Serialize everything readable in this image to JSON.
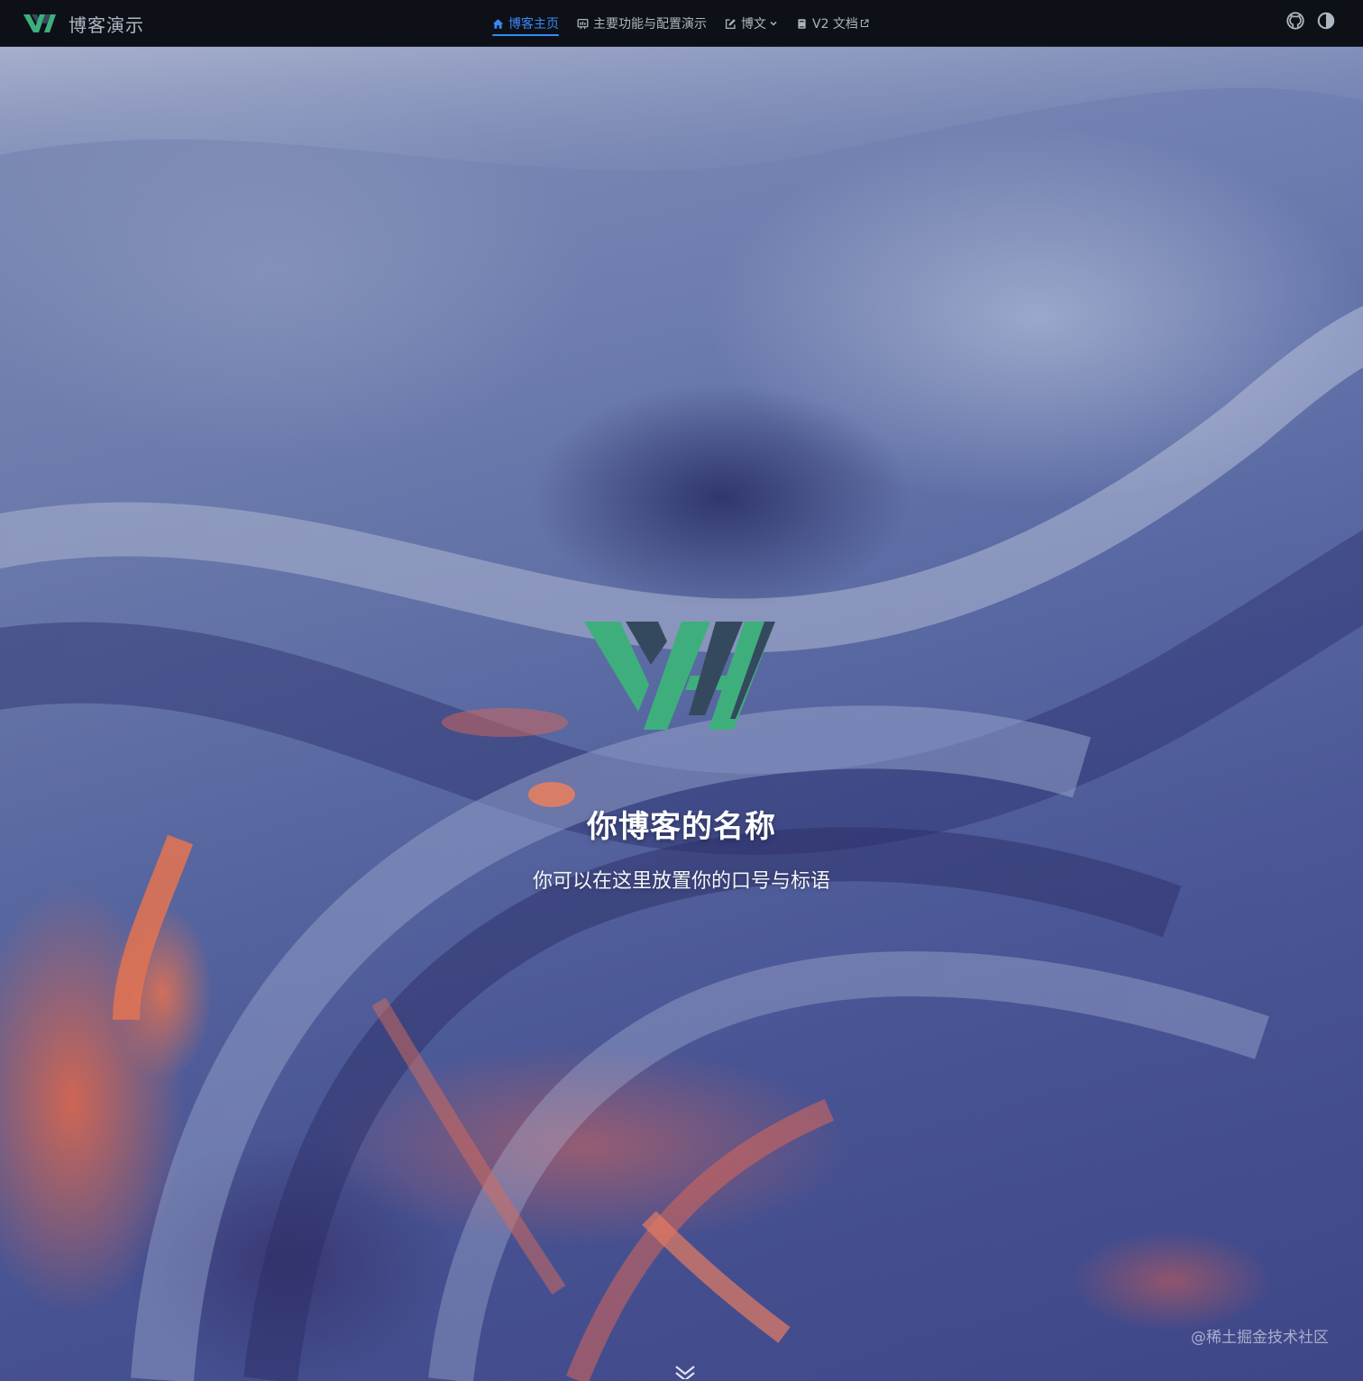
{
  "brand": {
    "name": "博客演示"
  },
  "nav": {
    "items": [
      {
        "label": "博客主页",
        "icon": "home-icon",
        "active": true
      },
      {
        "label": "主要功能与配置演示",
        "icon": "slides-icon"
      },
      {
        "label": "博文",
        "icon": "edit-icon",
        "dropdown": true
      },
      {
        "label": "V2 文档",
        "icon": "book-icon",
        "external": true
      }
    ]
  },
  "tools": {
    "github": "github-icon",
    "theme": "contrast-icon"
  },
  "hero": {
    "title": "你博客的名称",
    "tagline": "你可以在这里放置你的口号与标语"
  },
  "watermark": "@稀土掘金技术社区",
  "colors": {
    "accent": "#3b87f5",
    "logo_green": "#3eaf7c",
    "logo_dark": "#35495e",
    "nav_bg": "#0d1117"
  }
}
